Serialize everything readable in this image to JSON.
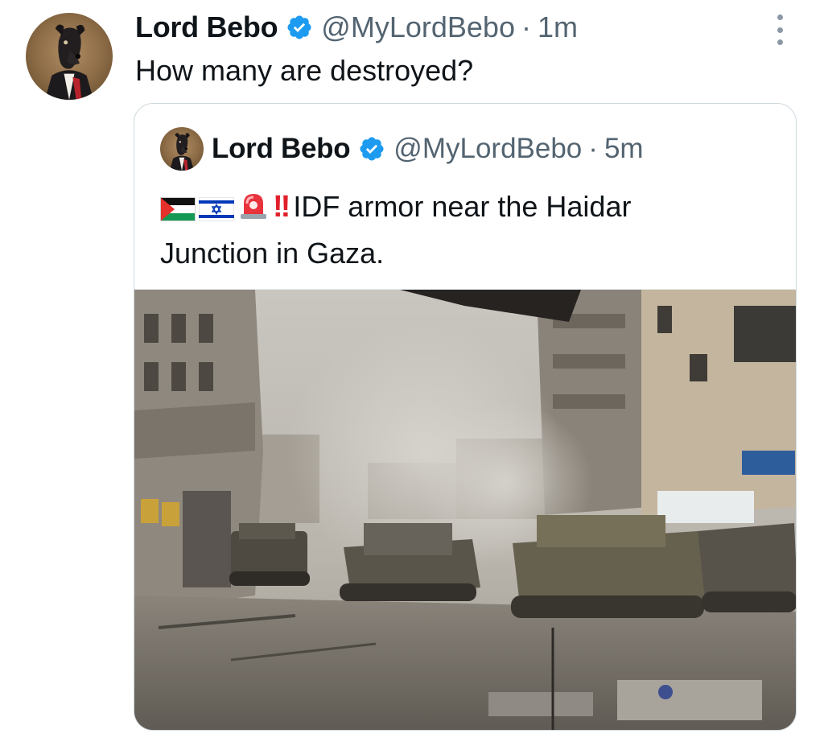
{
  "tweet": {
    "author_name": "Lord Bebo",
    "handle": "@MyLordBebo",
    "separator": "·",
    "time": "1m",
    "text": "How many are destroyed?",
    "avatar_icon": "dog-in-suit-avatar",
    "more_icon": "vertical-ellipsis-icon"
  },
  "quoted_tweet": {
    "author_name": "Lord Bebo",
    "handle": "@MyLordBebo",
    "separator": "·",
    "time": "5m",
    "emojis": [
      "palestine-flag",
      "israel-flag",
      "police-siren",
      "double-exclamation"
    ],
    "exclamation": "!!",
    "text_line1": "IDF armor near the Haidar",
    "text_line2": "Junction in Gaza.",
    "media_image": "photo-tanks-on-destroyed-gaza-street"
  },
  "colors": {
    "text_primary": "#0f1419",
    "text_secondary": "#536471",
    "verified_blue": "#1d9bf0",
    "border": "#cfd9de"
  }
}
